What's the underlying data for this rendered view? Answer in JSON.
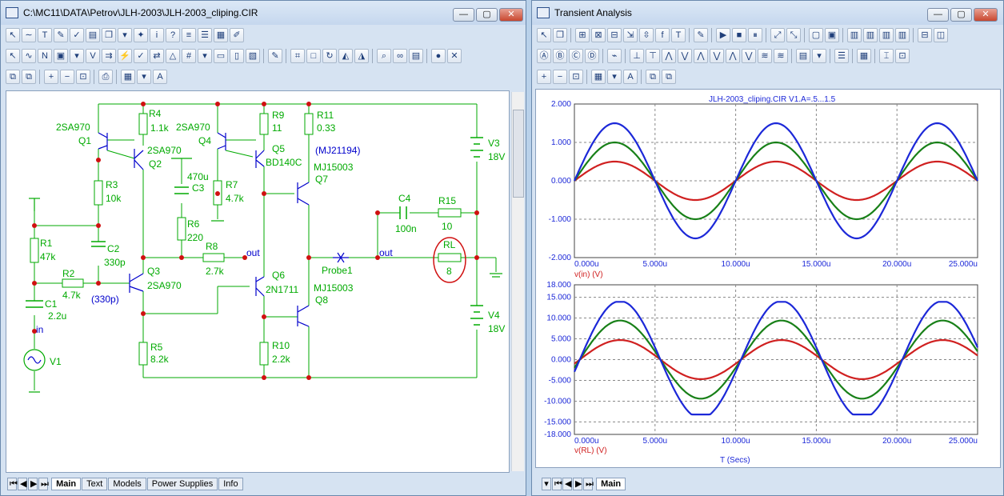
{
  "left_window": {
    "title": "C:\\MC11\\DATA\\Petrov\\JLH-2003\\JLH-2003_cliping.CIR",
    "tabs": [
      "Main",
      "Text",
      "Models",
      "Power Supplies",
      "Info"
    ],
    "active_tab": "Main"
  },
  "right_window": {
    "title": "Transient Analysis",
    "tabs": [
      "Main"
    ],
    "active_tab": "Main"
  },
  "window_buttons": {
    "minimize": "—",
    "maximize": "▢",
    "close": "✕"
  },
  "schematic": {
    "labels": {
      "q1_type": "2SA970",
      "q1": "Q1",
      "q2_type": "2SA970",
      "q2": "Q2",
      "q3": "Q3",
      "q3_type": "2SA970",
      "q4_type": "2SA970",
      "q4": "Q4",
      "q5": "Q5",
      "q5_type": "BD140C",
      "q6": "Q6",
      "q6_type": "2N1711",
      "q7_model": "(MJ21194)",
      "q7_type": "MJ15003",
      "q7": "Q7",
      "q8_type": "MJ15003",
      "q8": "Q8",
      "r1": "R1",
      "r1_val": "47k",
      "r2": "R2",
      "r2_val": "4.7k",
      "r3": "R3",
      "r3_val": "10k",
      "r4": "R4",
      "r4_val": "1.1k",
      "r5": "R5",
      "r5_val": "8.2k",
      "r6": "R6",
      "r6_val": "220",
      "r7": "R7",
      "r7_val": "4.7k",
      "r8": "R8",
      "r8_val": "2.7k",
      "r9": "R9",
      "r9_val": "11",
      "r10": "R10",
      "r10_val": "2.2k",
      "r11": "R11",
      "r11_val": "0.33",
      "r15": "R15",
      "r15_val": "10",
      "rl": "RL",
      "rl_val": "8",
      "c1": "C1",
      "c1_val": "2.2u",
      "c2": "C2",
      "c2_val": "330p",
      "c2_alt": "(330p)",
      "c3": "C3",
      "c3_val": "470u",
      "c4": "C4",
      "c4_val": "100n",
      "v1": "V1",
      "v3": "V3",
      "v3_val": "18V",
      "v4": "V4",
      "v4_val": "18V",
      "net_in": "in",
      "net_out_1": "out",
      "net_out_2": "out",
      "probe": "Probe1"
    }
  },
  "chart_data": [
    {
      "type": "line",
      "title": "JLH-2003_cliping.CIR V1.A=.5...1.5",
      "xlabel": "v(in) (V)",
      "x_ticks": [
        "0.000u",
        "5.000u",
        "10.000u",
        "15.000u",
        "20.000u",
        "25.000u"
      ],
      "y_ticks": [
        "2.000",
        "1.000",
        "0.000",
        "-1.000",
        "-2.000"
      ],
      "xlim": [
        0,
        25
      ],
      "ylim": [
        -2,
        2
      ],
      "x_unit": "u",
      "period": 10,
      "series": [
        {
          "color": "#d02020",
          "amplitude": 0.5
        },
        {
          "color": "#188018",
          "amplitude": 1.0
        },
        {
          "color": "#1c28d8",
          "amplitude": 1.5
        }
      ]
    },
    {
      "type": "line",
      "title": "",
      "xlabel": "v(RL) (V)",
      "x_axis_title": "T (Secs)",
      "x_ticks": [
        "0.000u",
        "5.000u",
        "10.000u",
        "15.000u",
        "20.000u",
        "25.000u"
      ],
      "y_ticks": [
        "18.000",
        "15.000",
        "10.000",
        "5.000",
        "0.000",
        "-5.000",
        "-10.000",
        "-15.000",
        "-18.000"
      ],
      "xlim": [
        0,
        25
      ],
      "ylim": [
        -18,
        18
      ],
      "period": 10,
      "series": [
        {
          "color": "#d02020",
          "amplitude": 4.7,
          "phase_deg": -12,
          "clip_low": null,
          "clip_high": null
        },
        {
          "color": "#188018",
          "amplitude": 9.4,
          "phase_deg": -12,
          "clip_low": null,
          "clip_high": null
        },
        {
          "color": "#1c28d8",
          "amplitude": 14.1,
          "phase_deg": -12,
          "clip_low": -13.2,
          "clip_high": 13.9
        }
      ]
    }
  ]
}
